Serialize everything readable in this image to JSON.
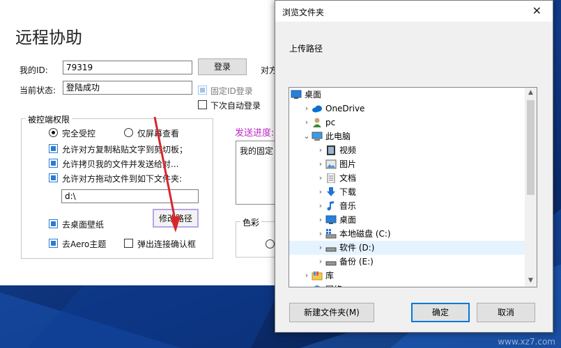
{
  "app": {
    "title": "远程协助",
    "my_id_label": "我的ID:",
    "my_id_value": "79319",
    "login_button": "登录",
    "peer_label_partial": "对方",
    "status_label": "当前状态:",
    "status_value": "登陆成功",
    "fixed_id_login": "固定ID登录",
    "auto_login_next": "下次自动登录",
    "permissions": {
      "group_title": "被控端权限",
      "full_control": "完全受控",
      "screen_only": "仅屏幕查看",
      "allow_clipboard": "允许对方复制粘贴文字到剪切板；",
      "allow_copy_files": "允许拷贝我的文件并发送给对...",
      "allow_drag_files": "允许对方拖动文件到如下文件夹:",
      "folder_path": "d:\\",
      "change_path_button": "修改路径",
      "remove_wallpaper": "去桌面壁纸",
      "remove_aero": "去Aero主题",
      "popup_confirm": "弹出连接确认框"
    },
    "send_progress_label": "发送进度:",
    "my_fixed_partial": "我的固定",
    "color_group_title": "色彩"
  },
  "dialog": {
    "title": "浏览文件夹",
    "close_glyph": "✕",
    "description": "上传路径",
    "tree": [
      {
        "label": "桌面",
        "icon": "desktop-icon",
        "depth": 0,
        "chevron": ""
      },
      {
        "label": "OneDrive",
        "icon": "onedrive-icon",
        "depth": 1,
        "chevron": "›"
      },
      {
        "label": "pc",
        "icon": "user-icon",
        "depth": 1,
        "chevron": "›"
      },
      {
        "label": "此电脑",
        "icon": "computer-icon",
        "depth": 1,
        "chevron": "⌄"
      },
      {
        "label": "视频",
        "icon": "video-folder-icon",
        "depth": 2,
        "chevron": "›"
      },
      {
        "label": "图片",
        "icon": "pictures-folder-icon",
        "depth": 2,
        "chevron": "›"
      },
      {
        "label": "文档",
        "icon": "documents-folder-icon",
        "depth": 2,
        "chevron": "›"
      },
      {
        "label": "下载",
        "icon": "downloads-folder-icon",
        "depth": 2,
        "chevron": "›"
      },
      {
        "label": "音乐",
        "icon": "music-folder-icon",
        "depth": 2,
        "chevron": "›"
      },
      {
        "label": "桌面",
        "icon": "desktop-icon",
        "depth": 2,
        "chevron": "›"
      },
      {
        "label": "本地磁盘 (C:)",
        "icon": "system-drive-icon",
        "depth": 2,
        "chevron": "›"
      },
      {
        "label": "软件 (D:)",
        "icon": "drive-icon",
        "depth": 2,
        "chevron": "›",
        "selected": true
      },
      {
        "label": "备份 (E:)",
        "icon": "drive-icon",
        "depth": 2,
        "chevron": "›"
      },
      {
        "label": "库",
        "icon": "library-icon",
        "depth": 1,
        "chevron": "›"
      },
      {
        "label": "网络",
        "icon": "network-icon",
        "depth": 1,
        "chevron": "›"
      }
    ],
    "new_folder_button": "新建文件夹(M)",
    "ok_button": "确定",
    "cancel_button": "取消"
  },
  "watermark": "www.xz7.com"
}
